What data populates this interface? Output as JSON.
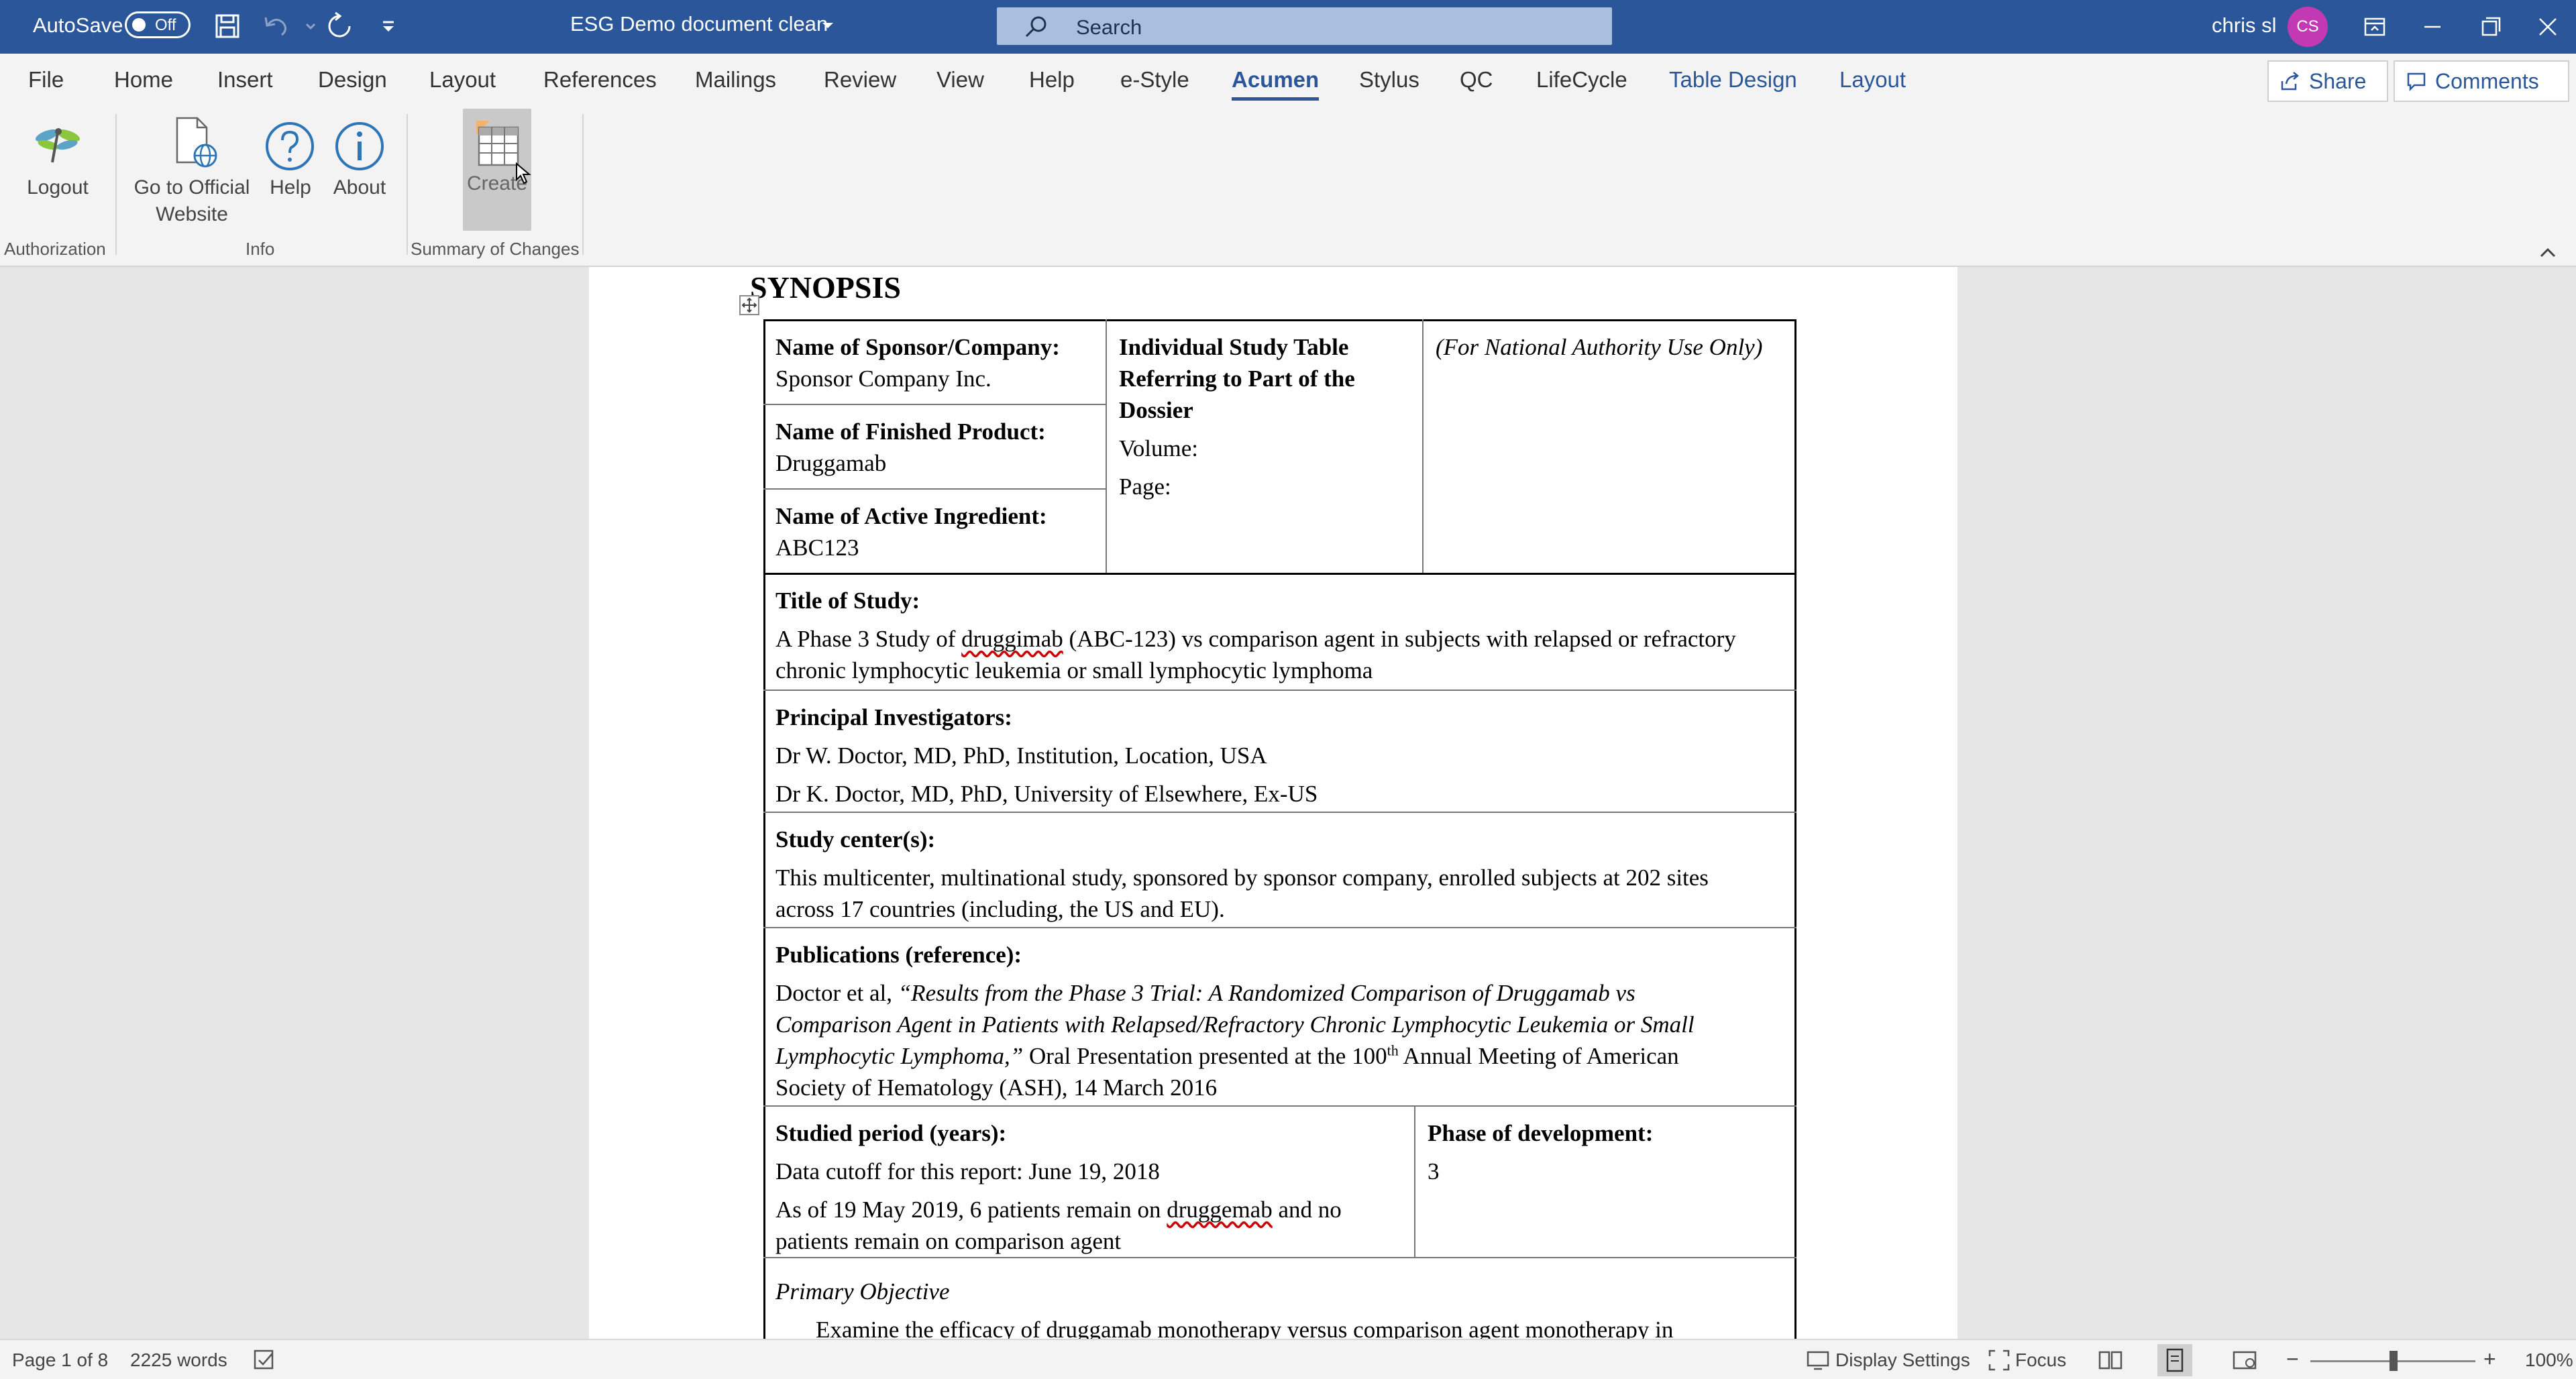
{
  "titlebar": {
    "autosave_label": "AutoSave",
    "autosave_state": "Off",
    "document_title": "ESG Demo document clean",
    "search_placeholder": "Search",
    "user_name": "chris sl",
    "user_initials": "CS",
    "accent_color": "#2b579a",
    "avatar_color": "#c239b3"
  },
  "menu": {
    "tabs": [
      "File",
      "Home",
      "Insert",
      "Design",
      "Layout",
      "References",
      "Mailings",
      "Review",
      "View",
      "Help",
      "e-Style",
      "Acumen",
      "Stylus",
      "QC",
      "LifeCycle",
      "Table Design",
      "Layout"
    ],
    "active_tab": "Acumen",
    "share_label": "Share",
    "comments_label": "Comments"
  },
  "ribbon": {
    "buttons": {
      "logout": "Logout",
      "go_official_line1": "Go to Official",
      "go_official_line2": "Website",
      "help": "Help",
      "about": "About",
      "create": "Create"
    },
    "groups": {
      "authorization": "Authorization",
      "info": "Info",
      "summary": "Summary of Changes"
    }
  },
  "document": {
    "heading": "SYNOPSIS",
    "sponsor_label": "Name of Sponsor/Company:",
    "sponsor_value": "Sponsor Company Inc.",
    "product_label": "Name of Finished Product:",
    "product_value": "Druggamab",
    "ingredient_label": "Name of Active Ingredient:",
    "ingredient_value": "ABC123",
    "individual_line1": "Individual Study Table",
    "individual_line2": "Referring to Part of the",
    "individual_line3": "Dossier",
    "volume_label": "Volume:",
    "page_label": "Page:",
    "national_use": "(For National Authority Use Only)",
    "title_label": "Title of Study:",
    "title_line1_a": "A Phase 3 Study of ",
    "title_line1_word": "druggimab",
    "title_line1_b": " (ABC-123) vs comparison agent in subjects with relapsed or refractory",
    "title_line2": "chronic lymphocytic leukemia or small lymphocytic lymphoma",
    "investigators_label": "Principal Investigators:",
    "investigator_1": "Dr W. Doctor, MD, PhD, Institution, Location, USA",
    "investigator_2": "Dr K. Doctor, MD, PhD, University of Elsewhere, Ex-US",
    "centers_label": "Study center(s):",
    "centers_line1": "This multicenter, multinational study, sponsored by sponsor company, enrolled subjects at 202 sites",
    "centers_line2": "across 17 countries (including, the US and EU).",
    "publications_label": "Publications (reference):",
    "pub_line1_a": "Doctor et al, ",
    "pub_line1_b": "“Results from the Phase 3 Trial: A Randomized Comparison of Druggamab vs",
    "pub_line2": "Comparison Agent in Patients with Relapsed/Refractory Chronic Lymphocytic Leukemia or Small",
    "pub_line3_a": "Lymphocytic Lymphoma,”",
    "pub_line3_b": " Oral Presentation presented at the 100",
    "pub_line3_sup": "th",
    "pub_line3_c": " Annual Meeting of American",
    "pub_line4": "Society of Hematology (ASH), 14 March 2016",
    "period_label": "Studied period (years):",
    "period_line1": "Data cutoff for this report: June 19, 2018",
    "period_line2_a": "As of 19 May 2019, 6 patients remain on ",
    "period_line2_word": "druggemab",
    "period_line2_b": " and no",
    "period_line3": "patients remain on comparison agent",
    "phase_label": "Phase of development:",
    "phase_value": "3",
    "objective_label": "Primary Objective",
    "objective_line1": "Examine the efficacy of druggamab monotherapy versus comparison agent monotherapy in"
  },
  "statusbar": {
    "page": "Page 1 of 8",
    "words": "2225 words",
    "display_settings": "Display Settings",
    "focus": "Focus",
    "zoom_minus": "−",
    "zoom_plus": "+",
    "zoom_level": "100%"
  }
}
